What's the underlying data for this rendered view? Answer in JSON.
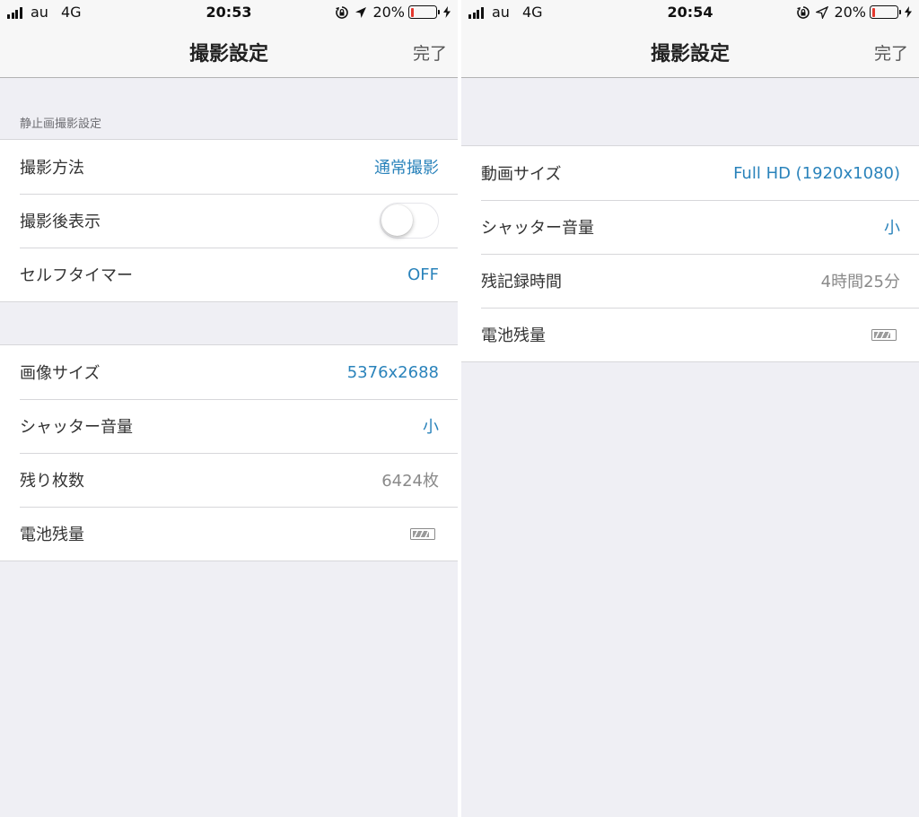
{
  "left": {
    "status": {
      "carrier": "au",
      "network": "4G",
      "time": "20:53",
      "battery_percent": "20%",
      "battery_level": 0.2
    },
    "nav": {
      "title": "撮影設定",
      "done": "完了"
    },
    "section_header": "静止画撮影設定",
    "group1": {
      "shoot_method": {
        "label": "撮影方法",
        "value": "通常撮影"
      },
      "post_display": {
        "label": "撮影後表示",
        "enabled": false
      },
      "self_timer": {
        "label": "セルフタイマー",
        "value": "OFF"
      }
    },
    "group2": {
      "image_size": {
        "label": "画像サイズ",
        "value": "5376x2688"
      },
      "shutter_volume": {
        "label": "シャッター音量",
        "value": "小"
      },
      "remaining_shots": {
        "label": "残り枚数",
        "value": "6424枚"
      },
      "battery": {
        "label": "電池残量",
        "level": 0.8
      }
    }
  },
  "right": {
    "status": {
      "carrier": "au",
      "network": "4G",
      "time": "20:54",
      "battery_percent": "20%",
      "battery_level": 0.2
    },
    "nav": {
      "title": "撮影設定",
      "done": "完了"
    },
    "group": {
      "video_size": {
        "label": "動画サイズ",
        "value": "Full HD (1920x1080)"
      },
      "shutter_volume": {
        "label": "シャッター音量",
        "value": "小"
      },
      "remaining_time": {
        "label": "残記録時間",
        "value": "4時間25分"
      },
      "battery": {
        "label": "電池残量",
        "level": 0.8
      }
    }
  },
  "colors": {
    "accent": "#2a83bb",
    "secondary_text": "#8a8a8a",
    "background": "#efeff4",
    "battery_low": "#e5392f"
  },
  "icons": [
    "signal-bars-icon",
    "orientation-lock-icon",
    "location-arrow-icon",
    "phone-battery-icon",
    "charging-bolt-icon",
    "camera-battery-icon"
  ]
}
